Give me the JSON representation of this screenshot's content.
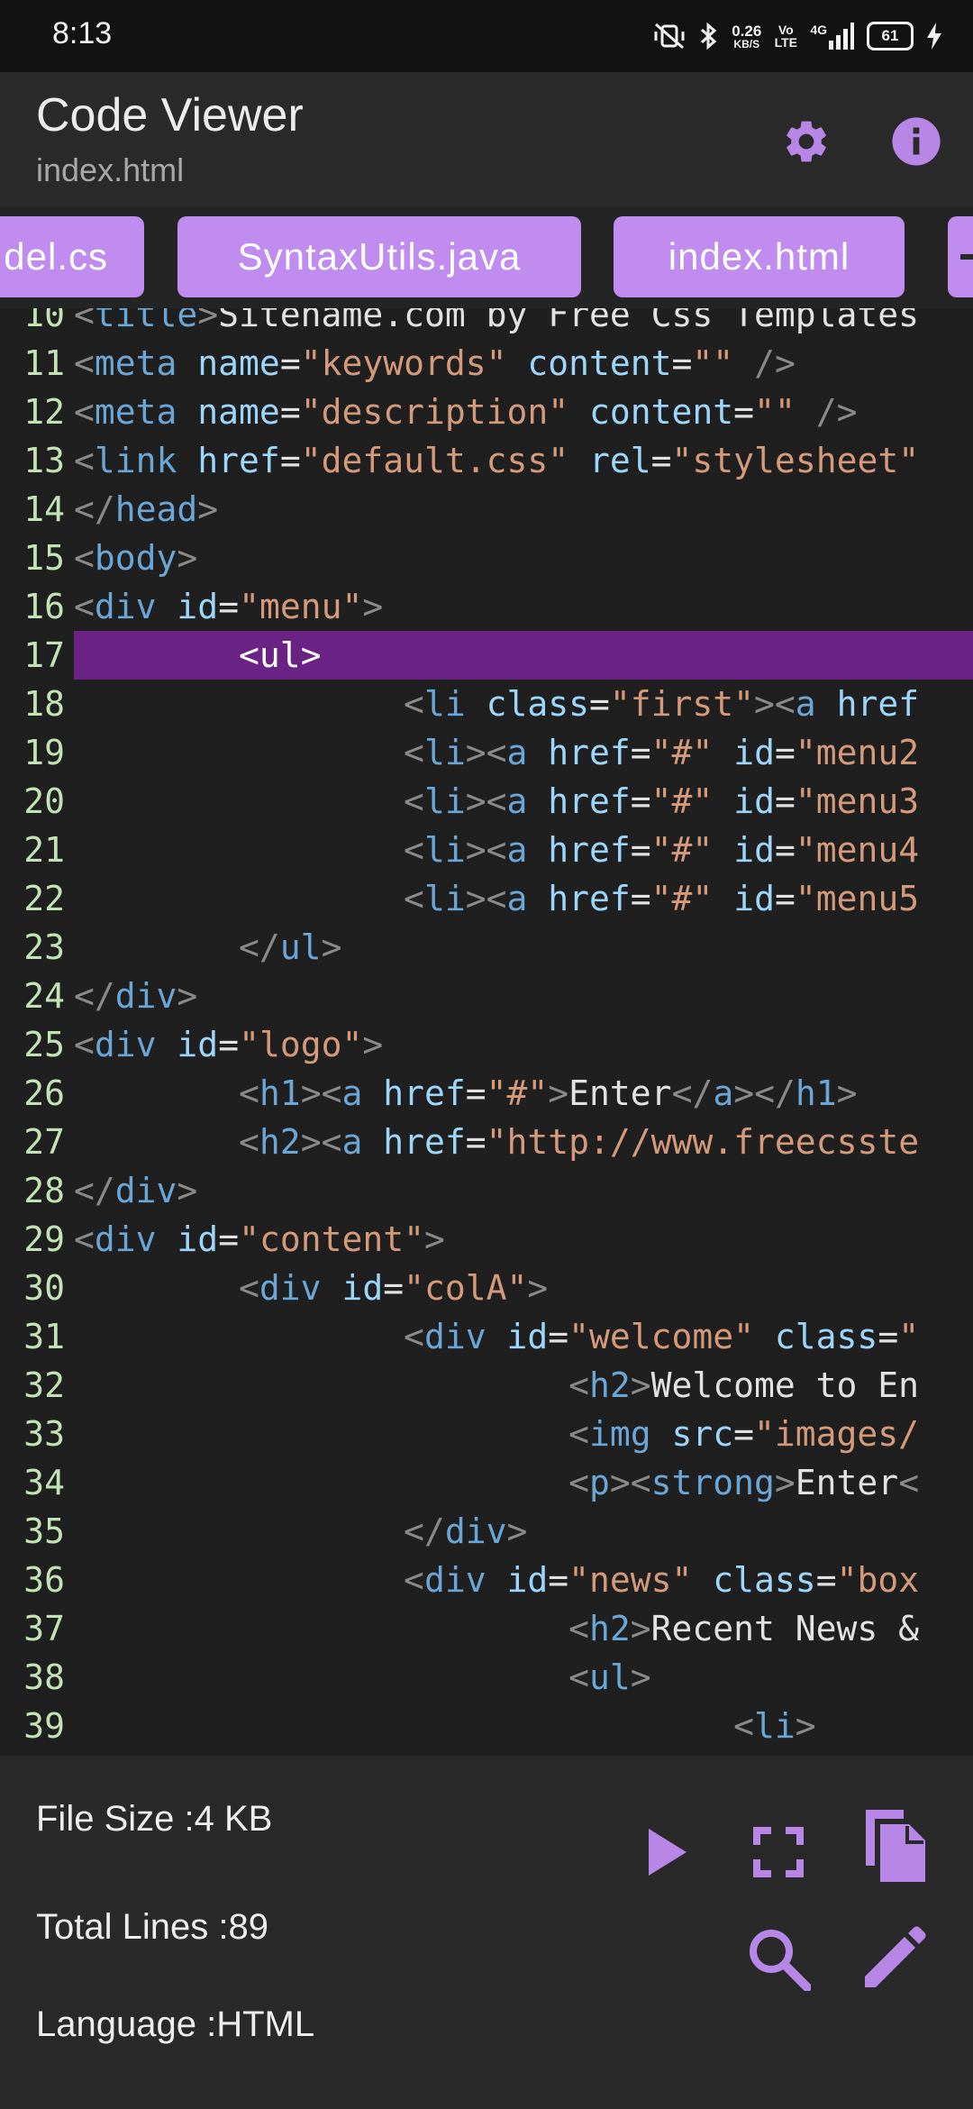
{
  "status": {
    "time": "8:13",
    "net_speed": "0.26",
    "net_unit": "KB/S",
    "volte": "Vo LTE",
    "network": "4G",
    "battery": "61"
  },
  "app": {
    "title": "Code Viewer",
    "subtitle": "index.html"
  },
  "icons": {
    "settings": "gear-icon",
    "info": "info-icon",
    "run": "play-icon",
    "fullscreen": "fullscreen-icon",
    "copy": "copy-icon",
    "search": "search-icon",
    "edit": "pencil-icon"
  },
  "colors": {
    "accent": "#c08cf0",
    "highlight": "#6a2384",
    "tag": "#6aa6d6",
    "attr": "#9cd6fb",
    "string": "#d49a7a",
    "line_number": "#c2e4b4"
  },
  "tabs": [
    "del.cs",
    "SyntaxUtils.java",
    "index.html"
  ],
  "code": {
    "highlighted_line": "17",
    "lines": [
      {
        "n": "10",
        "segs": [
          [
            "b",
            "<"
          ],
          [
            "t",
            "title"
          ],
          [
            "b",
            ">"
          ],
          [
            "x",
            "Sitename.com by Free Css Templates"
          ]
        ]
      },
      {
        "n": "11",
        "segs": [
          [
            "b",
            "<"
          ],
          [
            "t",
            "meta"
          ],
          [
            "x",
            " "
          ],
          [
            "a",
            "name"
          ],
          [
            "x",
            "="
          ],
          [
            "s",
            "\"keywords\""
          ],
          [
            "x",
            " "
          ],
          [
            "a",
            "content"
          ],
          [
            "x",
            "="
          ],
          [
            "s",
            "\"\""
          ],
          [
            "x",
            " "
          ],
          [
            "b",
            "/>"
          ]
        ]
      },
      {
        "n": "12",
        "segs": [
          [
            "b",
            "<"
          ],
          [
            "t",
            "meta"
          ],
          [
            "x",
            " "
          ],
          [
            "a",
            "name"
          ],
          [
            "x",
            "="
          ],
          [
            "s",
            "\"description\""
          ],
          [
            "x",
            " "
          ],
          [
            "a",
            "content"
          ],
          [
            "x",
            "="
          ],
          [
            "s",
            "\"\""
          ],
          [
            "x",
            " "
          ],
          [
            "b",
            "/>"
          ]
        ]
      },
      {
        "n": "13",
        "segs": [
          [
            "b",
            "<"
          ],
          [
            "t",
            "link"
          ],
          [
            "x",
            " "
          ],
          [
            "a",
            "href"
          ],
          [
            "x",
            "="
          ],
          [
            "s",
            "\"default.css\""
          ],
          [
            "x",
            " "
          ],
          [
            "a",
            "rel"
          ],
          [
            "x",
            "="
          ],
          [
            "s",
            "\"stylesheet\""
          ]
        ]
      },
      {
        "n": "14",
        "segs": [
          [
            "b",
            "</"
          ],
          [
            "t",
            "head"
          ],
          [
            "b",
            ">"
          ]
        ]
      },
      {
        "n": "15",
        "segs": [
          [
            "b",
            "<"
          ],
          [
            "t",
            "body"
          ],
          [
            "b",
            ">"
          ]
        ]
      },
      {
        "n": "16",
        "segs": [
          [
            "b",
            "<"
          ],
          [
            "t",
            "div"
          ],
          [
            "x",
            " "
          ],
          [
            "a",
            "id"
          ],
          [
            "x",
            "="
          ],
          [
            "s",
            "\"menu\""
          ],
          [
            "b",
            ">"
          ]
        ]
      },
      {
        "n": "17",
        "segs": [
          [
            "x",
            "        "
          ],
          [
            "b",
            "<"
          ],
          [
            "t",
            "ul"
          ],
          [
            "b",
            ">"
          ]
        ]
      },
      {
        "n": "18",
        "segs": [
          [
            "x",
            "                "
          ],
          [
            "b",
            "<"
          ],
          [
            "t",
            "li"
          ],
          [
            "x",
            " "
          ],
          [
            "a",
            "class"
          ],
          [
            "x",
            "="
          ],
          [
            "s",
            "\"first\""
          ],
          [
            "b",
            "><"
          ],
          [
            "t",
            "a"
          ],
          [
            "x",
            " "
          ],
          [
            "a",
            "href"
          ]
        ]
      },
      {
        "n": "19",
        "segs": [
          [
            "x",
            "                "
          ],
          [
            "b",
            "<"
          ],
          [
            "t",
            "li"
          ],
          [
            "b",
            "><"
          ],
          [
            "t",
            "a"
          ],
          [
            "x",
            " "
          ],
          [
            "a",
            "href"
          ],
          [
            "x",
            "="
          ],
          [
            "s",
            "\"#\""
          ],
          [
            "x",
            " "
          ],
          [
            "a",
            "id"
          ],
          [
            "x",
            "="
          ],
          [
            "s",
            "\"menu2"
          ]
        ]
      },
      {
        "n": "20",
        "segs": [
          [
            "x",
            "                "
          ],
          [
            "b",
            "<"
          ],
          [
            "t",
            "li"
          ],
          [
            "b",
            "><"
          ],
          [
            "t",
            "a"
          ],
          [
            "x",
            " "
          ],
          [
            "a",
            "href"
          ],
          [
            "x",
            "="
          ],
          [
            "s",
            "\"#\""
          ],
          [
            "x",
            " "
          ],
          [
            "a",
            "id"
          ],
          [
            "x",
            "="
          ],
          [
            "s",
            "\"menu3"
          ]
        ]
      },
      {
        "n": "21",
        "segs": [
          [
            "x",
            "                "
          ],
          [
            "b",
            "<"
          ],
          [
            "t",
            "li"
          ],
          [
            "b",
            "><"
          ],
          [
            "t",
            "a"
          ],
          [
            "x",
            " "
          ],
          [
            "a",
            "href"
          ],
          [
            "x",
            "="
          ],
          [
            "s",
            "\"#\""
          ],
          [
            "x",
            " "
          ],
          [
            "a",
            "id"
          ],
          [
            "x",
            "="
          ],
          [
            "s",
            "\"menu4"
          ]
        ]
      },
      {
        "n": "22",
        "segs": [
          [
            "x",
            "                "
          ],
          [
            "b",
            "<"
          ],
          [
            "t",
            "li"
          ],
          [
            "b",
            "><"
          ],
          [
            "t",
            "a"
          ],
          [
            "x",
            " "
          ],
          [
            "a",
            "href"
          ],
          [
            "x",
            "="
          ],
          [
            "s",
            "\"#\""
          ],
          [
            "x",
            " "
          ],
          [
            "a",
            "id"
          ],
          [
            "x",
            "="
          ],
          [
            "s",
            "\"menu5"
          ]
        ]
      },
      {
        "n": "23",
        "segs": [
          [
            "x",
            "        "
          ],
          [
            "b",
            "</"
          ],
          [
            "t",
            "ul"
          ],
          [
            "b",
            ">"
          ]
        ]
      },
      {
        "n": "24",
        "segs": [
          [
            "b",
            "</"
          ],
          [
            "t",
            "div"
          ],
          [
            "b",
            ">"
          ]
        ]
      },
      {
        "n": "25",
        "segs": [
          [
            "b",
            "<"
          ],
          [
            "t",
            "div"
          ],
          [
            "x",
            " "
          ],
          [
            "a",
            "id"
          ],
          [
            "x",
            "="
          ],
          [
            "s",
            "\"logo\""
          ],
          [
            "b",
            ">"
          ]
        ]
      },
      {
        "n": "26",
        "segs": [
          [
            "x",
            "        "
          ],
          [
            "b",
            "<"
          ],
          [
            "t",
            "h1"
          ],
          [
            "b",
            "><"
          ],
          [
            "t",
            "a"
          ],
          [
            "x",
            " "
          ],
          [
            "a",
            "href"
          ],
          [
            "x",
            "="
          ],
          [
            "s",
            "\"#\""
          ],
          [
            "b",
            ">"
          ],
          [
            "x",
            "Enter"
          ],
          [
            "b",
            "</"
          ],
          [
            "t",
            "a"
          ],
          [
            "b",
            "></"
          ],
          [
            "t",
            "h1"
          ],
          [
            "b",
            ">"
          ]
        ]
      },
      {
        "n": "27",
        "segs": [
          [
            "x",
            "        "
          ],
          [
            "b",
            "<"
          ],
          [
            "t",
            "h2"
          ],
          [
            "b",
            "><"
          ],
          [
            "t",
            "a"
          ],
          [
            "x",
            " "
          ],
          [
            "a",
            "href"
          ],
          [
            "x",
            "="
          ],
          [
            "s",
            "\"http://www.freecsste"
          ]
        ]
      },
      {
        "n": "28",
        "segs": [
          [
            "b",
            "</"
          ],
          [
            "t",
            "div"
          ],
          [
            "b",
            ">"
          ]
        ]
      },
      {
        "n": "29",
        "segs": [
          [
            "b",
            "<"
          ],
          [
            "t",
            "div"
          ],
          [
            "x",
            " "
          ],
          [
            "a",
            "id"
          ],
          [
            "x",
            "="
          ],
          [
            "s",
            "\"content\""
          ],
          [
            "b",
            ">"
          ]
        ]
      },
      {
        "n": "30",
        "segs": [
          [
            "x",
            "        "
          ],
          [
            "b",
            "<"
          ],
          [
            "t",
            "div"
          ],
          [
            "x",
            " "
          ],
          [
            "a",
            "id"
          ],
          [
            "x",
            "="
          ],
          [
            "s",
            "\"colA\""
          ],
          [
            "b",
            ">"
          ]
        ]
      },
      {
        "n": "31",
        "segs": [
          [
            "x",
            "                "
          ],
          [
            "b",
            "<"
          ],
          [
            "t",
            "div"
          ],
          [
            "x",
            " "
          ],
          [
            "a",
            "id"
          ],
          [
            "x",
            "="
          ],
          [
            "s",
            "\"welcome\""
          ],
          [
            "x",
            " "
          ],
          [
            "a",
            "class"
          ],
          [
            "x",
            "="
          ],
          [
            "s",
            "\""
          ]
        ]
      },
      {
        "n": "32",
        "segs": [
          [
            "x",
            "                        "
          ],
          [
            "b",
            "<"
          ],
          [
            "t",
            "h2"
          ],
          [
            "b",
            ">"
          ],
          [
            "x",
            "Welcome to En"
          ]
        ]
      },
      {
        "n": "33",
        "segs": [
          [
            "x",
            "                        "
          ],
          [
            "b",
            "<"
          ],
          [
            "t",
            "img"
          ],
          [
            "x",
            " "
          ],
          [
            "a",
            "src"
          ],
          [
            "x",
            "="
          ],
          [
            "s",
            "\"images/"
          ]
        ]
      },
      {
        "n": "34",
        "segs": [
          [
            "x",
            "                        "
          ],
          [
            "b",
            "<"
          ],
          [
            "t",
            "p"
          ],
          [
            "b",
            "><"
          ],
          [
            "t",
            "strong"
          ],
          [
            "b",
            ">"
          ],
          [
            "x",
            "Enter"
          ],
          [
            "b",
            "<"
          ]
        ]
      },
      {
        "n": "35",
        "segs": [
          [
            "x",
            "                "
          ],
          [
            "b",
            "</"
          ],
          [
            "t",
            "div"
          ],
          [
            "b",
            ">"
          ]
        ]
      },
      {
        "n": "36",
        "segs": [
          [
            "x",
            "                "
          ],
          [
            "b",
            "<"
          ],
          [
            "t",
            "div"
          ],
          [
            "x",
            " "
          ],
          [
            "a",
            "id"
          ],
          [
            "x",
            "="
          ],
          [
            "s",
            "\"news\""
          ],
          [
            "x",
            " "
          ],
          [
            "a",
            "class"
          ],
          [
            "x",
            "="
          ],
          [
            "s",
            "\"box"
          ]
        ]
      },
      {
        "n": "37",
        "segs": [
          [
            "x",
            "                        "
          ],
          [
            "b",
            "<"
          ],
          [
            "t",
            "h2"
          ],
          [
            "b",
            ">"
          ],
          [
            "x",
            "Recent News &"
          ]
        ]
      },
      {
        "n": "38",
        "segs": [
          [
            "x",
            "                        "
          ],
          [
            "b",
            "<"
          ],
          [
            "t",
            "ul"
          ],
          [
            "b",
            ">"
          ]
        ]
      },
      {
        "n": "39",
        "segs": [
          [
            "x",
            "                                "
          ],
          [
            "b",
            "<"
          ],
          [
            "t",
            "li"
          ],
          [
            "b",
            ">"
          ]
        ]
      }
    ]
  },
  "info": {
    "file_size": "File Size :4 KB",
    "total_lines": "Total Lines :89",
    "language": "Language :HTML"
  }
}
